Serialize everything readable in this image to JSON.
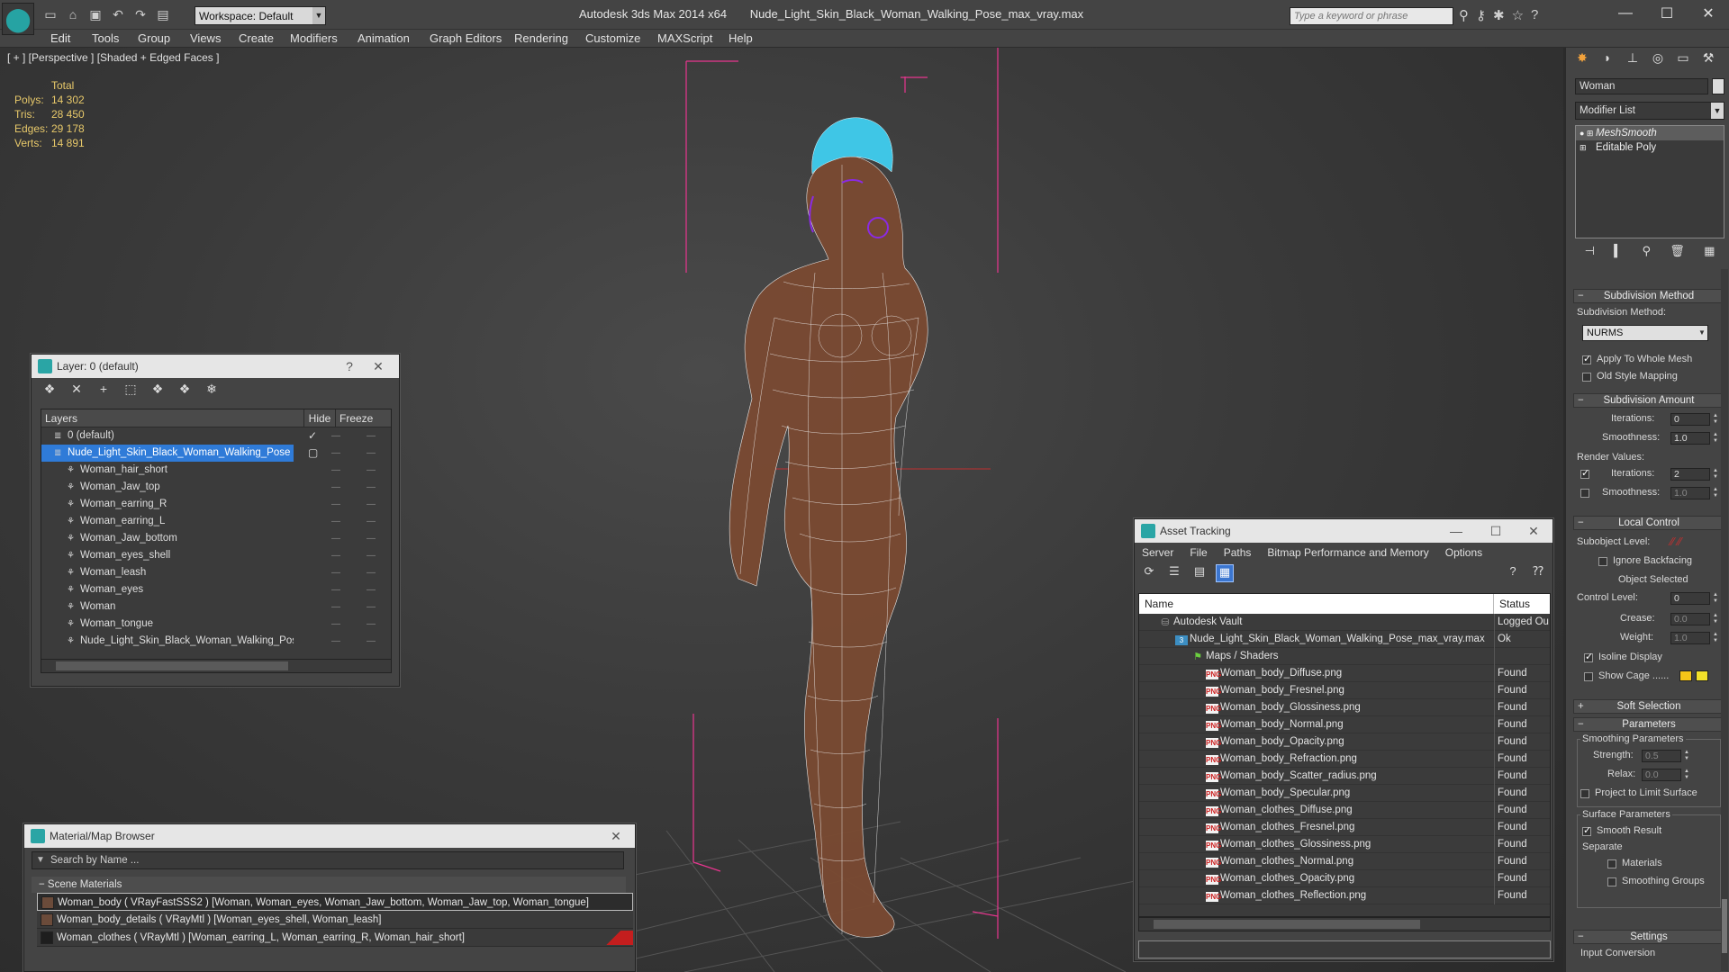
{
  "titlebar": {
    "workspace": "Workspace: Default",
    "app_name": "Autodesk 3ds Max  2014 x64",
    "file_name": "Nude_Light_Skin_Black_Woman_Walking_Pose_max_vray.max",
    "search_placeholder": "Type a keyword or phrase",
    "minimize": "—",
    "maximize": "☐",
    "close": "✕"
  },
  "menu": [
    "Edit",
    "Tools",
    "Group",
    "Views",
    "Create",
    "Modifiers",
    "Animation",
    "Graph Editors",
    "Rendering",
    "Customize",
    "MAXScript",
    "Help"
  ],
  "viewport": {
    "label": "[ + ] [Perspective ] [Shaded + Edged Faces ]",
    "stats": {
      "total_label": "Total",
      "rows": [
        {
          "k": "Polys:",
          "v": "14 302"
        },
        {
          "k": "Tris:",
          "v": "28 450"
        },
        {
          "k": "Edges:",
          "v": "29 178"
        },
        {
          "k": "Verts:",
          "v": "14 891"
        }
      ]
    }
  },
  "layer_window": {
    "title": "Layer: 0 (default)",
    "help": "?",
    "close": "✕",
    "col_layers": "Layers",
    "col_hide": "Hide",
    "col_freeze": "Freeze",
    "rows": [
      {
        "name": "0 (default)",
        "level": 1,
        "selected": false,
        "check": true
      },
      {
        "name": "Nude_Light_Skin_Black_Woman_Walking_Pose",
        "level": 1,
        "selected": true,
        "check": false
      },
      {
        "name": "Woman_hair_short",
        "level": 2
      },
      {
        "name": "Woman_Jaw_top",
        "level": 2
      },
      {
        "name": "Woman_earring_R",
        "level": 2
      },
      {
        "name": "Woman_earring_L",
        "level": 2
      },
      {
        "name": "Woman_Jaw_bottom",
        "level": 2
      },
      {
        "name": "Woman_eyes_shell",
        "level": 2
      },
      {
        "name": "Woman_leash",
        "level": 2
      },
      {
        "name": "Woman_eyes",
        "level": 2
      },
      {
        "name": "Woman",
        "level": 2
      },
      {
        "name": "Woman_tongue",
        "level": 2
      },
      {
        "name": "Nude_Light_Skin_Black_Woman_Walking_Pose",
        "level": 2
      }
    ]
  },
  "material_browser": {
    "title": "Material/Map Browser",
    "close": "✕",
    "search_placeholder": "Search by Name ...",
    "section": "Scene Materials",
    "rows": [
      {
        "text": "Woman_body  ( VRayFastSSS2 )  [Woman, Woman_eyes, Woman_Jaw_bottom, Woman_Jaw_top, Woman_tongue]",
        "selected": true
      },
      {
        "text": "Woman_body_details  ( VRayMtl )  [Woman_eyes_shell, Woman_leash]",
        "selected": false
      },
      {
        "text": "Woman_clothes  ( VRayMtl )  [Woman_earring_L, Woman_earring_R, Woman_hair_short]",
        "selected": false
      }
    ]
  },
  "asset_tracking": {
    "title": "Asset Tracking",
    "minimize": "—",
    "maximize": "☐",
    "close": "✕",
    "menu": [
      "Server",
      "File",
      "Paths",
      "Bitmap Performance and Memory",
      "Options"
    ],
    "col_name": "Name",
    "col_status": "Status",
    "rows": [
      {
        "name": "Autodesk Vault",
        "status": "Logged Ou",
        "indent": 18,
        "icon": "vault"
      },
      {
        "name": "Nude_Light_Skin_Black_Woman_Walking_Pose_max_vray.max",
        "status": "Ok",
        "indent": 36,
        "icon": "max"
      },
      {
        "name": "Maps / Shaders",
        "status": "",
        "indent": 54,
        "icon": "maps"
      },
      {
        "name": "Woman_body_Diffuse.png",
        "status": "Found",
        "indent": 70,
        "icon": "png"
      },
      {
        "name": "Woman_body_Fresnel.png",
        "status": "Found",
        "indent": 70,
        "icon": "png"
      },
      {
        "name": "Woman_body_Glossiness.png",
        "status": "Found",
        "indent": 70,
        "icon": "png"
      },
      {
        "name": "Woman_body_Normal.png",
        "status": "Found",
        "indent": 70,
        "icon": "png"
      },
      {
        "name": "Woman_body_Opacity.png",
        "status": "Found",
        "indent": 70,
        "icon": "png"
      },
      {
        "name": "Woman_body_Refraction.png",
        "status": "Found",
        "indent": 70,
        "icon": "png"
      },
      {
        "name": "Woman_body_Scatter_radius.png",
        "status": "Found",
        "indent": 70,
        "icon": "png"
      },
      {
        "name": "Woman_body_Specular.png",
        "status": "Found",
        "indent": 70,
        "icon": "png"
      },
      {
        "name": "Woman_clothes_Diffuse.png",
        "status": "Found",
        "indent": 70,
        "icon": "png"
      },
      {
        "name": "Woman_clothes_Fresnel.png",
        "status": "Found",
        "indent": 70,
        "icon": "png"
      },
      {
        "name": "Woman_clothes_Glossiness.png",
        "status": "Found",
        "indent": 70,
        "icon": "png"
      },
      {
        "name": "Woman_clothes_Normal.png",
        "status": "Found",
        "indent": 70,
        "icon": "png"
      },
      {
        "name": "Woman_clothes_Opacity.png",
        "status": "Found",
        "indent": 70,
        "icon": "png"
      },
      {
        "name": "Woman_clothes_Reflection.png",
        "status": "Found",
        "indent": 70,
        "icon": "png"
      }
    ]
  },
  "command_panel": {
    "object_name": "Woman",
    "modifier_list": "Modifier List",
    "stack": [
      {
        "label": "MeshSmooth",
        "selected": true
      },
      {
        "label": "Editable Poly",
        "selected": false
      }
    ],
    "subdivision_method": {
      "title": "Subdivision Method",
      "method_label": "Subdivision Method:",
      "method_value": "NURMS",
      "apply_whole_mesh": "Apply To Whole Mesh",
      "old_style": "Old Style Mapping"
    },
    "subdivision_amount": {
      "title": "Subdivision Amount",
      "iterations_label": "Iterations:",
      "iterations": "0",
      "smoothness_label": "Smoothness:",
      "smoothness": "1.0",
      "render_values": "Render Values:",
      "r_iterations_label": "Iterations:",
      "r_iterations": "2",
      "r_smoothness_label": "Smoothness:",
      "r_smoothness": "1.0"
    },
    "local_control": {
      "title": "Local Control",
      "subobject_label": "Subobject Level:",
      "ignore_backfacing": "Ignore Backfacing",
      "object_selected": "Object Selected",
      "control_level_label": "Control Level:",
      "control_level": "0",
      "crease_label": "Crease:",
      "crease": "0.0",
      "weight_label": "Weight:",
      "weight": "1.0",
      "isoline": "Isoline Display",
      "show_cage": "Show Cage ......"
    },
    "soft_selection": "Soft Selection",
    "parameters": {
      "title": "Parameters",
      "smoothing_params": "Smoothing Parameters",
      "strength_label": "Strength:",
      "strength": "0.5",
      "relax_label": "Relax:",
      "relax": "0.0",
      "project_limit": "Project to Limit Surface",
      "surface_params": "Surface Parameters",
      "smooth_result": "Smooth Result",
      "separate": "Separate",
      "materials": "Materials",
      "smoothing_groups": "Smoothing Groups"
    },
    "settings": {
      "title": "Settings",
      "input_conversion": "Input Conversion"
    }
  },
  "colors": {
    "selection_blue": "#2f7bd8",
    "stats_yellow": "#e8c96a",
    "wire_pink": "#e8358f",
    "hair_cyan": "#3fc6e6",
    "skin_brown": "#7a4a32",
    "cage_yellow": "#f5c518"
  }
}
